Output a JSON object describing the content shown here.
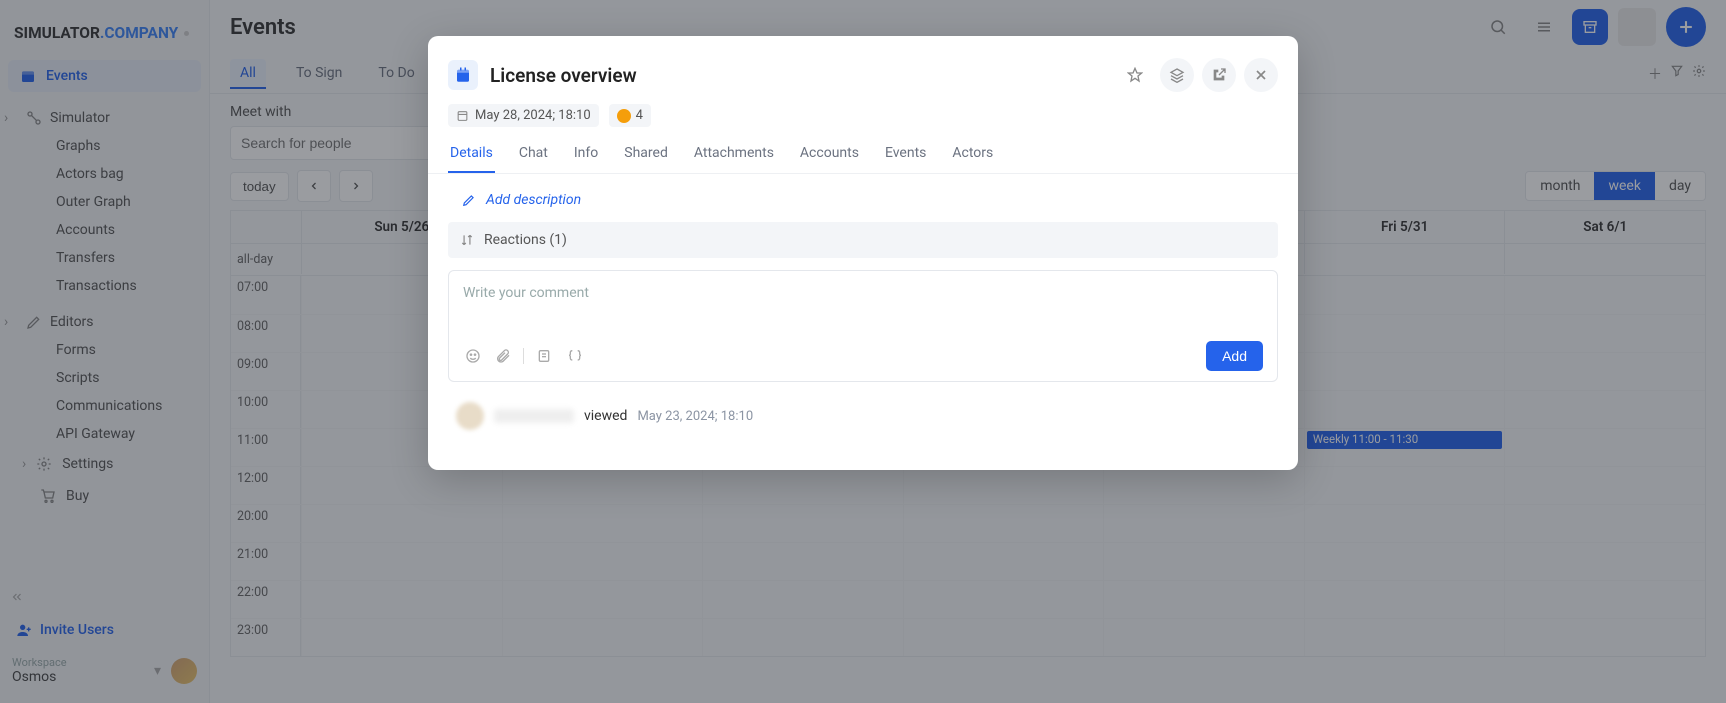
{
  "brand": {
    "part1": "SIMULATOR",
    "part2": ".COMPANY"
  },
  "sidebar": {
    "primary": {
      "label": "Events"
    },
    "groups": [
      {
        "title": "Simulator",
        "items": [
          "Graphs",
          "Actors bag",
          "Outer Graph",
          "Accounts",
          "Transfers",
          "Transactions"
        ]
      },
      {
        "title": "Editors",
        "items": [
          "Forms",
          "Scripts",
          "Communications",
          "API Gateway"
        ]
      }
    ],
    "flat": [
      {
        "label": "Settings"
      },
      {
        "label": "Buy"
      }
    ],
    "invite": "Invite Users",
    "workspace": {
      "label": "Workspace",
      "name": "Osmos"
    }
  },
  "page": {
    "title": "Events",
    "tabs": [
      "All",
      "To Sign",
      "To Do"
    ],
    "meetwith": "Meet with",
    "search_placeholder": "Search for people",
    "today_label": "today",
    "view": {
      "month": "month",
      "week": "week",
      "day": "day"
    },
    "days": [
      "Sun 5/26",
      "",
      "",
      "",
      "",
      "Fri 5/31",
      "Sat 6/1"
    ],
    "allday": "all-day",
    "hours": [
      "07:00",
      "08:00",
      "09:00",
      "10:00",
      "11:00",
      "12:00",
      "20:00",
      "21:00",
      "22:00",
      "23:00"
    ],
    "event_chip": "Weekly 11:00 - 11:30"
  },
  "modal": {
    "title": "License overview",
    "date": "May 28, 2024; 18:10",
    "count": "4",
    "tabs": [
      "Details",
      "Chat",
      "Info",
      "Shared",
      "Attachments",
      "Accounts",
      "Events",
      "Actors"
    ],
    "add_desc": "Add description",
    "reactions_hdr": "Reactions (1)",
    "comment_placeholder": "Write your comment",
    "add_btn": "Add",
    "reaction": {
      "action": "viewed",
      "time": "May 23, 2024; 18:10"
    }
  }
}
